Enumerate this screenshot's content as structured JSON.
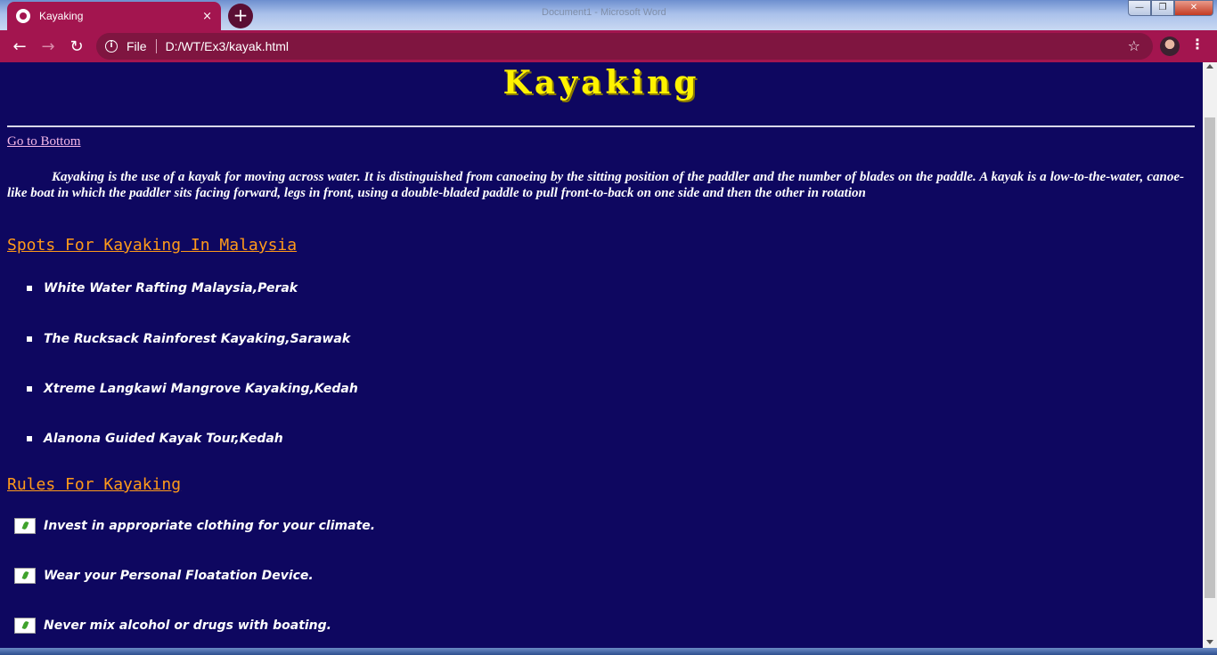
{
  "browser": {
    "tab_title": "Kayaking",
    "tab_close": "×",
    "new_tab": "+",
    "background_window_title": "Document1 - Microsoft Word",
    "window_buttons": {
      "minimize": "—",
      "maximize": "❐",
      "close": "✕"
    },
    "back": "←",
    "forward": "→",
    "reload": "↻",
    "url_scheme_label": "File",
    "url": "D:/WT/Ex3/kayak.html",
    "info_icon": "i",
    "bookmark_icon": "☆",
    "menu_icon": "⋮"
  },
  "page": {
    "heading": "Kayaking",
    "go_to_bottom": "Go to Bottom",
    "intro": "Kayaking is the use of a kayak for moving across water. It is distinguished from canoeing by the sitting position of the paddler and the number of blades on the paddle. A kayak is a low-to-the-water, canoe-like boat in which the paddler sits facing forward, legs in front, using a double-bladed paddle to pull front-to-back on one side and then the other in rotation",
    "spots_title": "Spots For Kayaking In Malaysia",
    "spots": [
      "White Water Rafting Malaysia,Perak",
      "The Rucksack Rainforest Kayaking,Sarawak",
      "Xtreme Langkawi Mangrove Kayaking,Kedah",
      "Alanona Guided Kayak Tour,Kedah"
    ],
    "rules_title": "Rules For Kayaking",
    "rules": [
      "Invest in appropriate clothing for your climate.",
      "Wear your Personal Floatation Device.",
      "Never mix alcohol or drugs with boating."
    ]
  },
  "colors": {
    "page_background": "#0e0760",
    "heading": "#fff200",
    "section_title": "#ff9a1a",
    "link": "#f5b8e8",
    "browser_accent": "#a3154f"
  }
}
